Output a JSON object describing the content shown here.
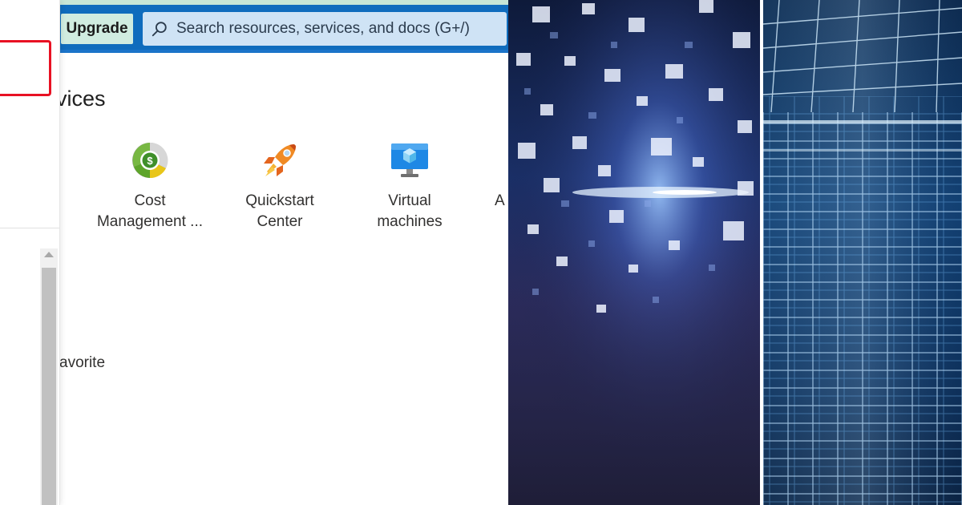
{
  "toolbar": {
    "upgrade_label": "Upgrade"
  },
  "search": {
    "placeholder": "Search resources, services, and docs (G+/)"
  },
  "services": {
    "section_title": "vices",
    "items": [
      {
        "label": "Cost\nManagement ...",
        "icon": "cost-management-icon"
      },
      {
        "label": "Quickstart\nCenter",
        "icon": "rocket-icon"
      },
      {
        "label": "Virtual\nmachines",
        "icon": "virtual-machine-icon"
      }
    ],
    "cut_off_label": "A"
  },
  "favorites": {
    "text": "avorite"
  },
  "colors": {
    "topbar": "#0f6cbd",
    "upgrade_bg": "#d0ece0",
    "search_bg": "#cfe3f5",
    "highlight_border": "#e81123"
  }
}
